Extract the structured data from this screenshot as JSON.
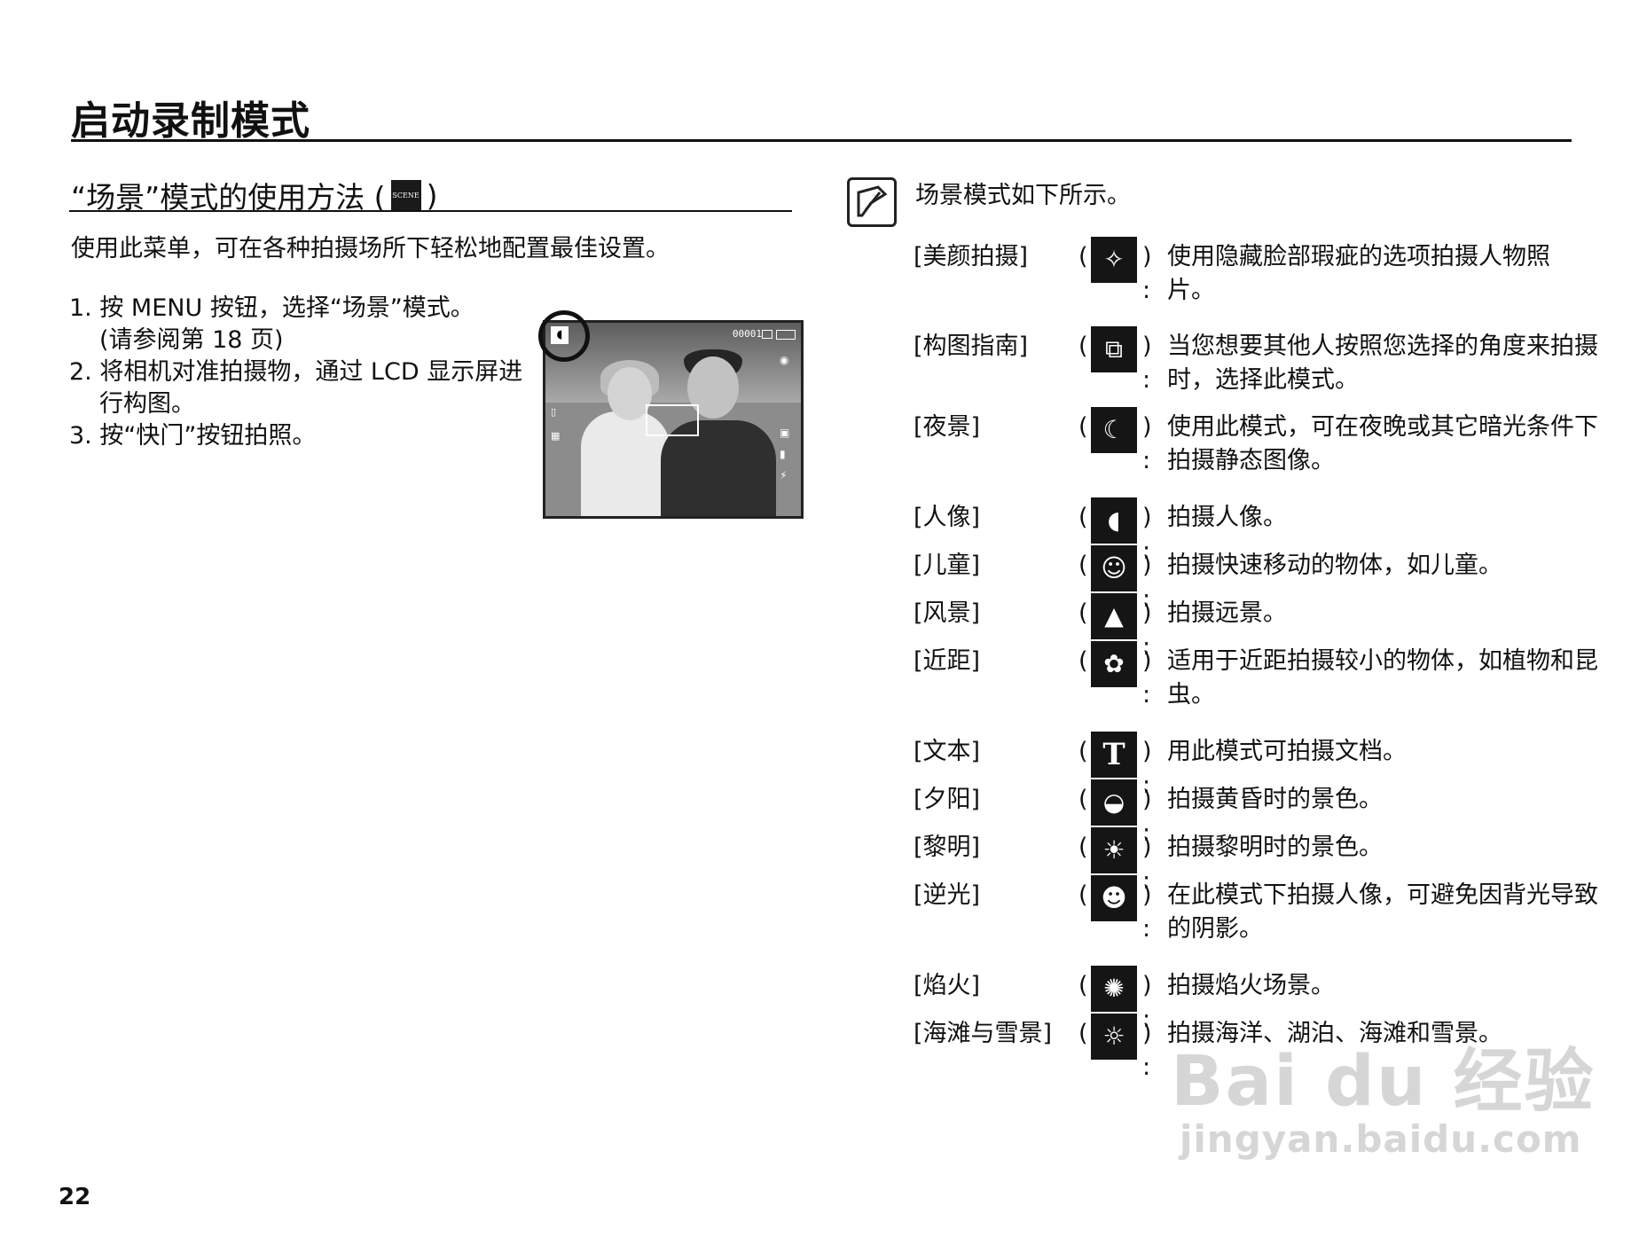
{
  "page_title": "启动录制模式",
  "section": {
    "heading_before": "“场景”模式的使用方法 (",
    "heading_badge": "SCENE",
    "heading_after": ")",
    "intro": "使用此菜单，可在各种拍摄场所下轻松地配置最佳设置。"
  },
  "steps": [
    "1. 按 MENU 按钮，选择“场景”模式。",
    "(请参阅第 18 页)",
    "2. 将相机对准拍摄物，通过 LCD 显示屏进",
    "行构图。",
    "3. 按“快门”按钮拍照。"
  ],
  "lcd": {
    "counter": "00001"
  },
  "note": {
    "icon": "note-icon",
    "text": "场景模式如下所示。"
  },
  "modes": [
    {
      "name": "[美颜拍摄]",
      "icon": "beauty-shot-icon",
      "glyph": "✧",
      "desc": "使用隐藏脸部瑕疵的选项拍摄人物照",
      "desc2": "片。"
    },
    {
      "name": "[构图指南]",
      "icon": "frame-guide-icon",
      "glyph": "⧉",
      "desc": "当您想要其他人按照您选择的角度来拍摄",
      "desc2": "时，选择此模式。"
    },
    {
      "name": "[夜景]",
      "icon": "night-icon",
      "glyph": "☾",
      "desc": "使用此模式，可在夜晚或其它暗光条件下",
      "desc2": "拍摄静态图像。"
    },
    {
      "name": "[人像]",
      "icon": "portrait-icon",
      "glyph": "◖",
      "desc": "拍摄人像。",
      "desc2": ""
    },
    {
      "name": "[儿童]",
      "icon": "children-icon",
      "glyph": "☺",
      "desc": "拍摄快速移动的物体，如儿童。",
      "desc2": ""
    },
    {
      "name": "[风景]",
      "icon": "landscape-icon",
      "glyph": "▲",
      "desc": "拍摄远景。",
      "desc2": ""
    },
    {
      "name": "[近距]",
      "icon": "close-up-icon",
      "glyph": "✿",
      "desc": "适用于近距拍摄较小的物体，如植物和昆",
      "desc2": "虫。"
    },
    {
      "name": "[文本]",
      "icon": "text-icon",
      "glyph": "T",
      "desc": "用此模式可拍摄文档。",
      "desc2": ""
    },
    {
      "name": "[夕阳]",
      "icon": "sunset-icon",
      "glyph": "◒",
      "desc": "拍摄黄昏时的景色。",
      "desc2": ""
    },
    {
      "name": "[黎明]",
      "icon": "dawn-icon",
      "glyph": "☀",
      "desc": "拍摄黎明时的景色。",
      "desc2": ""
    },
    {
      "name": "[逆光]",
      "icon": "backlight-icon",
      "glyph": "☻",
      "desc": "在此模式下拍摄人像，可避免因背光导致",
      "desc2": "的阴影。"
    },
    {
      "name": "[焰火]",
      "icon": "fireworks-icon",
      "glyph": "✺",
      "desc": "拍摄焰火场景。",
      "desc2": ""
    },
    {
      "name": "[海滩与雪景]",
      "icon": "beach-snow-icon",
      "glyph": "☼",
      "desc": "拍摄海洋、湖泊、海滩和雪景。",
      "desc2": ""
    }
  ],
  "page_number": "22",
  "watermark": {
    "line1": "Bai du 经验",
    "line2": "jingyan.baidu.com"
  }
}
